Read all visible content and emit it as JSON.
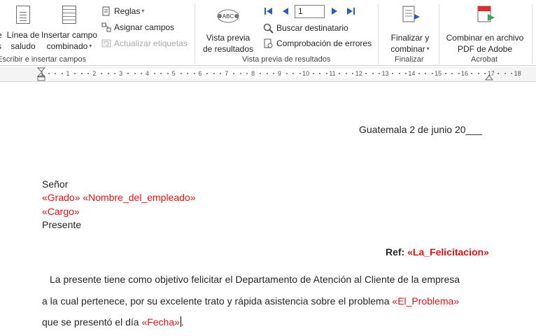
{
  "ribbon": {
    "groups": {
      "write_insert": "Escribir e insertar campos",
      "preview": "Vista previa de resultados",
      "finish": "Finalizar",
      "acrobat": "Acrobat"
    },
    "greeting_line": {
      "line1": "Línea de",
      "line2": "saludo"
    },
    "insert_field": {
      "line1": "Insertar campo",
      "line2": "combinado"
    },
    "rules": "Reglas",
    "match_fields": "Asignar campos",
    "update_labels": "Actualizar etiquetas",
    "preview_results": {
      "line1": "Vista previa",
      "line2": "de resultados"
    },
    "record_number": "1",
    "find_recipient": "Buscar destinatario",
    "check_errors": "Comprobación de errores",
    "finish_merge": {
      "line1": "Finalizar y",
      "line2": "combinar"
    },
    "merge_pdf": {
      "line1": "Combinar en archivo",
      "line2": "PDF de Adobe"
    },
    "icons": {
      "first": "first-record-icon",
      "prev": "previous-record-icon",
      "next": "next-record-icon",
      "last": "last-record-icon"
    },
    "colors": {
      "nav_blue": "#2b5fad",
      "field_red": "#e01616"
    }
  },
  "ruler": {
    "numbers": [
      "1",
      "1",
      "2",
      "3",
      "4",
      "5",
      "6",
      "7",
      "8",
      "9",
      "10",
      "11",
      "12",
      "13",
      "14",
      "15",
      "16",
      "17",
      "18"
    ]
  },
  "document": {
    "date_line": "Guatemala 2 de junio 20___",
    "salutation": "Señor",
    "field_grado": "«Grado»",
    "field_nombre": "«Nombre_del_empleado»",
    "field_cargo": "«Cargo»",
    "presente": "Presente",
    "ref_label": "Ref:",
    "field_felicitacion": "«La_Felicitacion»",
    "body_line1": "La presente tiene como objetivo felicitar el Departamento de Atención al Cliente de la empresa",
    "body_line2": "a la cual pertenece, por su excelente trato y rápida asistencia sobre el problema",
    "field_problema": "«El_Problema»",
    "body_line3": "que se presentó el día",
    "field_fecha": "«Fecha»",
    "period": "."
  }
}
